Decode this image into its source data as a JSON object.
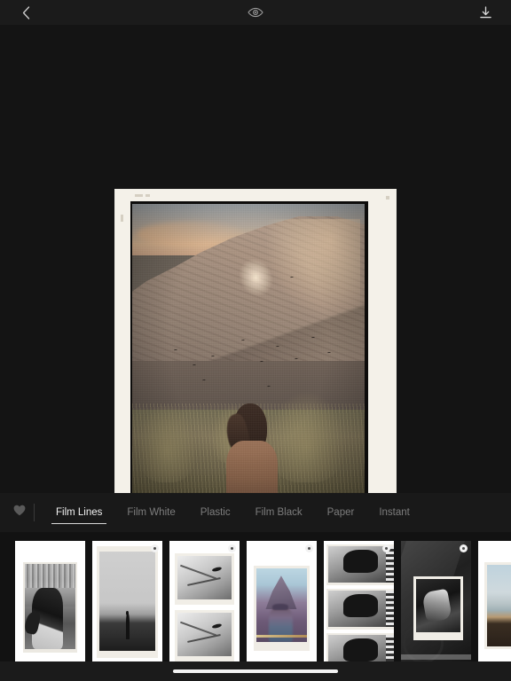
{
  "topbar": {
    "back_icon": "chevron-left-icon",
    "preview_icon": "eye-icon",
    "download_icon": "download-icon"
  },
  "preview": {
    "description": "Person in a brown coat walking through tall dry grass toward a large rocky mountain at golden hour, shown inside a white film-border frame",
    "frame_style": "Film Lines"
  },
  "tabbar": {
    "favorites_icon": "heart-icon",
    "tabs": [
      {
        "label": "Film Lines",
        "active": true
      },
      {
        "label": "Film White",
        "active": false
      },
      {
        "label": "Plastic",
        "active": false
      },
      {
        "label": "Film Black",
        "active": false
      },
      {
        "label": "Paper",
        "active": false
      },
      {
        "label": "Instant",
        "active": false
      }
    ]
  },
  "thumbnails": [
    {
      "name": "thumb-harbour-portrait",
      "locked": false
    },
    {
      "name": "thumb-foggy-field",
      "locked": true
    },
    {
      "name": "thumb-horse-pair",
      "locked": true
    },
    {
      "name": "thumb-mountain-hiker",
      "locked": true
    },
    {
      "name": "thumb-contact-sheet",
      "locked": true
    },
    {
      "name": "thumb-dark-study",
      "locked": true
    },
    {
      "name": "thumb-seaside",
      "locked": false
    }
  ],
  "home_indicator": {
    "visible": true
  },
  "colors": {
    "background": "#141414",
    "topbar": "#1b1b1b",
    "tabbar": "#191919",
    "strip": "#121212",
    "active_tab": "#f2f2f2",
    "inactive_tab": "#7d7d7d",
    "accent_underline": "#d8d8d8",
    "frame_paper": "#f4f1e9"
  }
}
